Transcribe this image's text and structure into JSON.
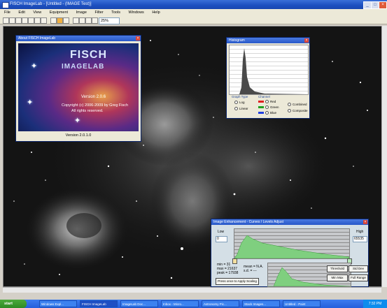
{
  "window": {
    "title": "FISCH ImageLab - [Untitled - (IMAGE Test)]"
  },
  "menu": [
    "File",
    "Edit",
    "View",
    "Equipment",
    "Image",
    "Filter",
    "Tools",
    "Windows",
    "Help"
  ],
  "toolbar": {
    "zoom_value": "25%"
  },
  "about": {
    "title": "About FISCH ImageLab",
    "brand_line1": "FISCH",
    "brand_line2": "IMAGELAB",
    "version": "Version 2.0.6",
    "copyright": "Copyright (c) 2006-2009 by Greg Fisch",
    "rights": "All rights reserved.",
    "footer": "Version 2.0.1.0"
  },
  "histogram": {
    "title": "Histogram",
    "graph_type_label": "Graph Type",
    "graph_types": [
      "Log",
      "Linear"
    ],
    "channel_label": "Channel",
    "channels": [
      {
        "name": "Red",
        "color": "#e02020"
      },
      {
        "name": "Green",
        "color": "#20a020"
      },
      {
        "name": "Blue",
        "color": "#2040e0"
      }
    ],
    "modes": [
      "Combined",
      "Composite"
    ]
  },
  "stretch": {
    "title": "Image Enhancement - Curves / Levels Adjust",
    "low_label": "Low",
    "low_value": "0",
    "high_label": "High",
    "high_value": "65535",
    "stats": {
      "min": "min = 31",
      "max": "max = 21637",
      "peak": "peak = 17938",
      "mean": "mean = N.A.",
      "sigma": "s.d. = ---"
    },
    "buttons": {
      "preview": "Press once to Apply Scaling",
      "threshold": "Threshold",
      "std_dev": "Std Dev",
      "min_max": "Min Max",
      "full_range": "Full Range"
    }
  },
  "taskbar": {
    "start": "start",
    "items": [
      "Windows Expl...",
      "FISCH ImageLab",
      "ImageLab Doc...",
      "Inbox - Micro...",
      "Astronomy Pic...",
      "Stack Images...",
      "Untitled - Paint"
    ],
    "clock": "7:32 PM"
  }
}
